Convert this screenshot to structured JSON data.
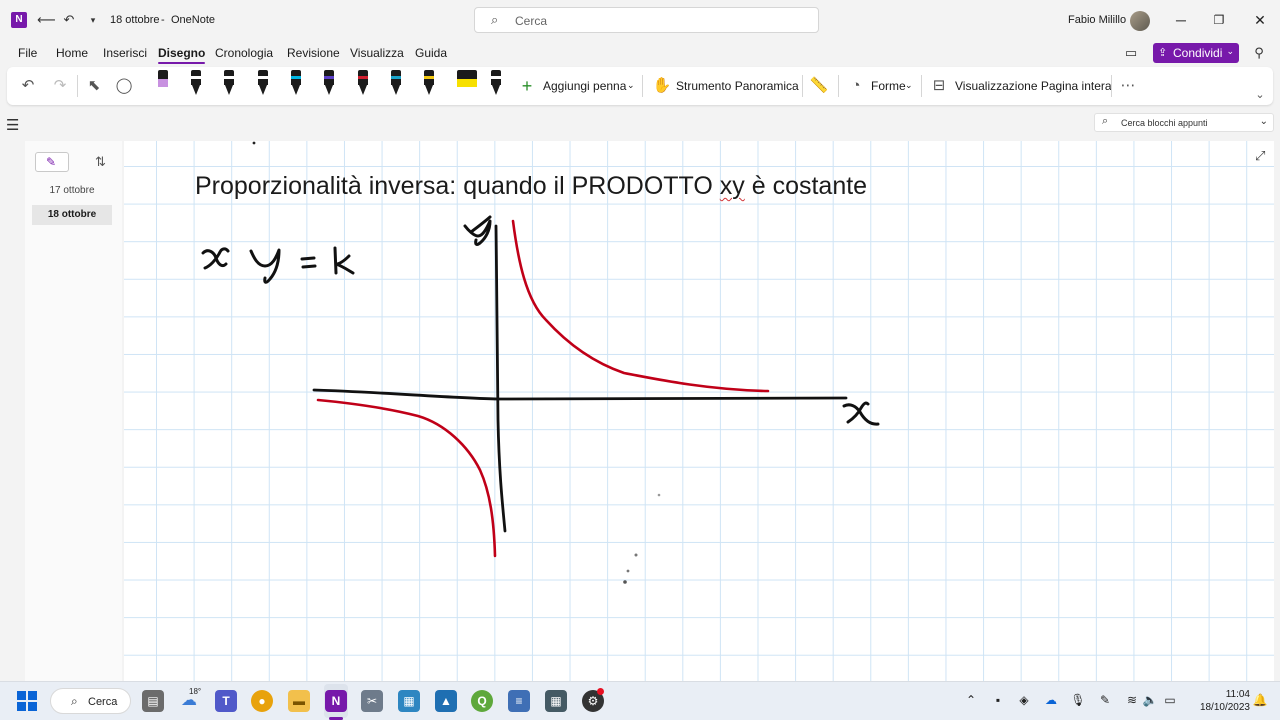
{
  "titlebar": {
    "quick_icons": [
      "back-icon",
      "undo-icon",
      "customize-qat-icon"
    ],
    "document_title": "18 ottobre",
    "separator": "-",
    "app_name": "OneNote",
    "search_placeholder": "Cerca",
    "user_name": "Fabio Milillo"
  },
  "menu": {
    "items": [
      "File",
      "Home",
      "Inserisci",
      "Disegno",
      "Cronologia",
      "Revisione",
      "Visualizza",
      "Guida"
    ],
    "active": "Disegno",
    "share_label": "Condividi"
  },
  "ribbon": {
    "pens": [
      {
        "name": "pink-highlighter",
        "color": "#c891e0"
      },
      {
        "name": "black-pen",
        "color": "#1b1b1b"
      },
      {
        "name": "black-pen-2",
        "color": "#1b1b1b"
      },
      {
        "name": "black-pen-selected",
        "color": "#1b1b1b",
        "selected": true
      },
      {
        "name": "cyan-pen",
        "color": "#00b7e4"
      },
      {
        "name": "purple-pen",
        "color": "#5b3fc8"
      },
      {
        "name": "red-pen",
        "color": "#d01f2f"
      },
      {
        "name": "teal-pen",
        "color": "#19a2c8"
      },
      {
        "name": "yellow-pen",
        "color": "#f2c811"
      },
      {
        "name": "yellow-highlighter",
        "color": "#f7e000"
      },
      {
        "name": "black-pen-3",
        "color": "#1b1b1b"
      }
    ],
    "add_pen_label": "Aggiungi penna",
    "pan_tool_label": "Strumento Panoramica",
    "shapes_label": "Forme",
    "full_page_view_label": "Visualizzazione Pagina intera"
  },
  "notebook_search_placeholder": "Cerca blocchi appunti",
  "pages": [
    {
      "label": "17 ottobre",
      "selected": false
    },
    {
      "label": "18 ottobre",
      "selected": true
    }
  ],
  "canvas": {
    "title_before": "Proporzionalità inversa: quando il PRODOTTO ",
    "title_flagged": "xy",
    "title_after": " è costante",
    "ink_colors": {
      "black": "#111111",
      "red": "#c00018"
    }
  },
  "taskbar": {
    "search_label": "Cerca",
    "weather_temp": "18°",
    "time": "11:04",
    "date": "18/10/2023"
  }
}
